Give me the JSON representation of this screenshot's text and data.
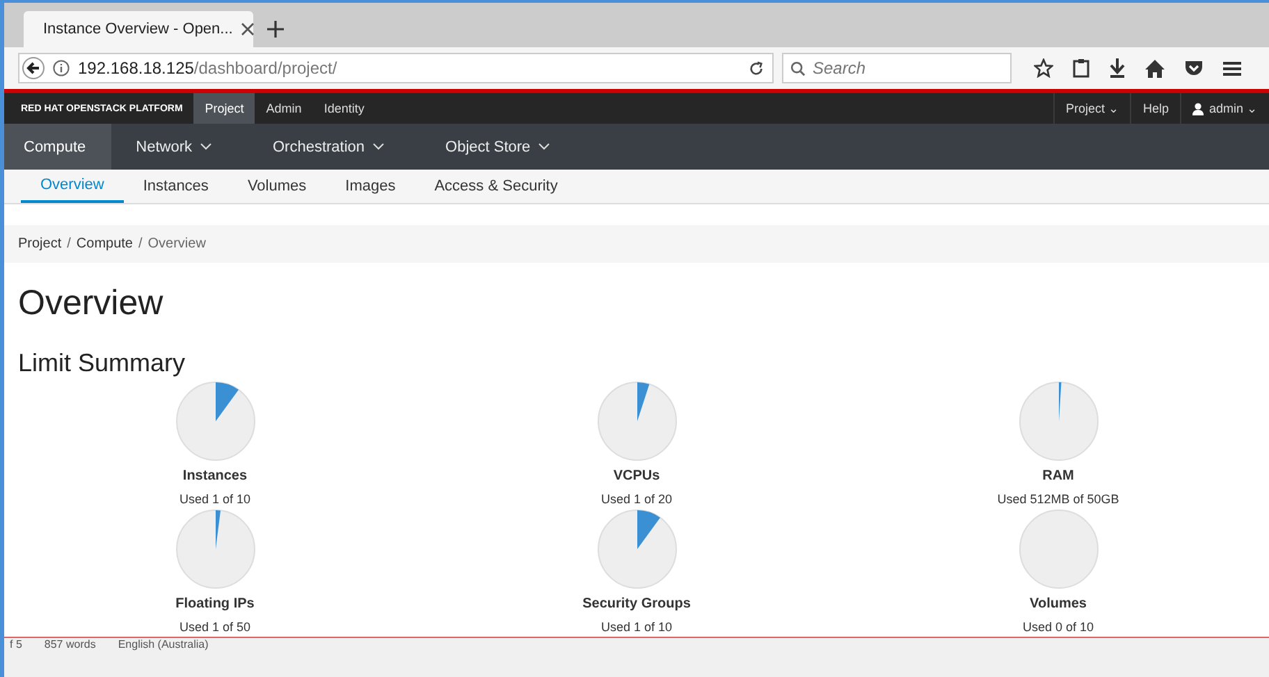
{
  "browser": {
    "tab_title": "Instance Overview - Open...",
    "url_host": "192.168.18.125",
    "url_path": "/dashboard/project/",
    "search_placeholder": "Search"
  },
  "topbar": {
    "brand": "RED HAT OPENSTACK PLATFORM",
    "tabs": [
      {
        "label": "Project",
        "selected": true
      },
      {
        "label": "Admin",
        "selected": false
      },
      {
        "label": "Identity",
        "selected": false
      }
    ],
    "right": [
      "Project ⌄",
      "Help",
      "admin ⌄"
    ]
  },
  "nav": [
    {
      "label": "Compute",
      "selected": true,
      "dropdown": false
    },
    {
      "label": "Network",
      "selected": false,
      "dropdown": true
    },
    {
      "label": "Orchestration",
      "selected": false,
      "dropdown": true
    },
    {
      "label": "Object Store",
      "selected": false,
      "dropdown": true
    }
  ],
  "subnav": [
    {
      "label": "Overview",
      "selected": true
    },
    {
      "label": "Instances",
      "selected": false
    },
    {
      "label": "Volumes",
      "selected": false
    },
    {
      "label": "Images",
      "selected": false
    },
    {
      "label": "Access & Security",
      "selected": false
    }
  ],
  "breadcrumb": [
    {
      "label": "Project",
      "separator": "/"
    },
    {
      "label": "Compute",
      "separator": "/"
    },
    {
      "label": "Overview"
    }
  ],
  "heading": "Overview",
  "section": "Limit Summary",
  "limits": [
    {
      "name": "Instances",
      "usage": "Used 1 of 10"
    },
    {
      "name": "VCPUs",
      "usage": "Used 1 of 20"
    },
    {
      "name": "RAM",
      "usage": "Used 512MB of 50GB"
    },
    {
      "name": "Floating IPs",
      "usage": "Used 1 of 50"
    },
    {
      "name": "Security Groups",
      "usage": "Used 1 of 10"
    },
    {
      "name": "Volumes",
      "usage": "Used 0 of 10"
    }
  ],
  "status_bar": [
    "f 5",
    "857 words",
    "English (Australia)"
  ]
}
